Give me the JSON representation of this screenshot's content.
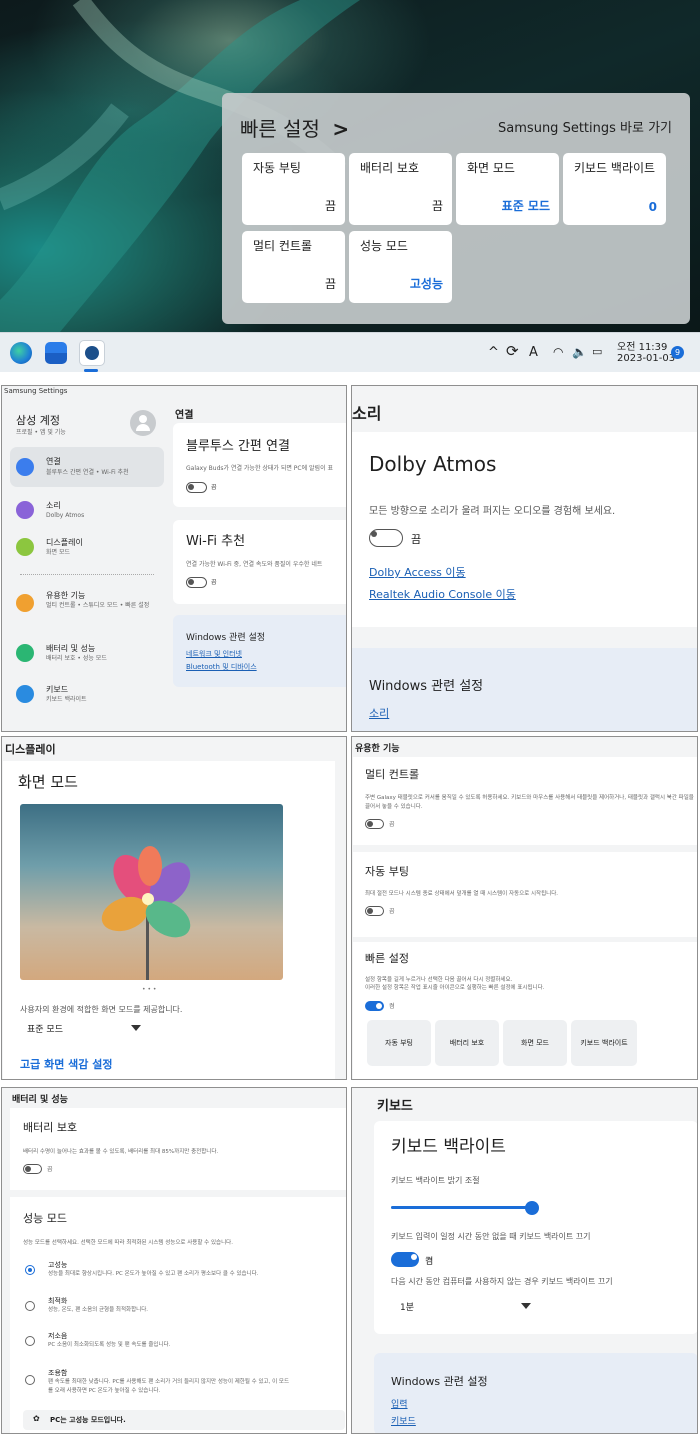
{
  "quick_settings": {
    "title": "빠른 설정",
    "chevron": ">",
    "shortcut": "Samsung Settings 바로 가기",
    "tiles": [
      {
        "label": "자동 부팅",
        "value": "끔"
      },
      {
        "label": "배터리 보호",
        "value": "끔"
      },
      {
        "label": "화면 모드",
        "value": "표준 모드"
      },
      {
        "label": "키보드 백라이트",
        "value": "0"
      },
      {
        "label": "멀티 컨트롤",
        "value": "끔"
      },
      {
        "label": "성능 모드",
        "value": "고성능"
      }
    ]
  },
  "taskbar": {
    "chevron": "^",
    "lang": "A",
    "time": "오전 11:39",
    "date": "2023-01-03",
    "badge": "9"
  },
  "settings_app": {
    "window_title": "Samsung Settings",
    "account": {
      "title": "삼성 계정",
      "sub": "프로필 • 앱 및 기능"
    },
    "nav": [
      {
        "title": "연결",
        "sub": "블루투스 간편 연결 • Wi-Fi 추천"
      },
      {
        "title": "소리",
        "sub": "Dolby Atmos"
      },
      {
        "title": "디스플레이",
        "sub": "화면 모드"
      },
      {
        "title": "유용한 기능",
        "sub": "멀티 컨트롤 • 스튜디오 모드 • 빠른 설정"
      },
      {
        "title": "배터리 및 성능",
        "sub": "배터리 보호 • 성능 모드"
      },
      {
        "title": "키보드",
        "sub": "키보드 백라이트"
      }
    ],
    "page_title": "연결",
    "bt": {
      "title": "블루투스 간편 연결",
      "desc": "Galaxy Buds가 연결 가능한 상태가 되면 PC에 알림이 표",
      "state": "끔"
    },
    "wifi": {
      "title": "Wi-Fi 추천",
      "desc": "연결 가능한 Wi-Fi 중, 연결 속도와 품질이 우수한 네트",
      "state": "끔"
    },
    "windows": {
      "title": "Windows 관련 설정",
      "link1": "네트워크 및 인터넷",
      "link2": "Bluetooth 및 디바이스"
    }
  },
  "sound": {
    "header": "소리",
    "title": "Dolby Atmos",
    "desc": "모든 방향으로 소리가 울려 퍼지는 오디오를 경험해 보세요.",
    "state": "끔",
    "link1": "Dolby Access 이동",
    "link2": "Realtek Audio Console 이동",
    "win_title": "Windows 관련 설정",
    "win_link": "소리"
  },
  "display": {
    "header": "디스플레이",
    "title": "화면 모드",
    "dots": "• • •",
    "desc": "사용자의 환경에 적합한 화면 모드를 제공합니다.",
    "select": "표준 모드",
    "advanced": "고급 화면 색감 설정"
  },
  "useful": {
    "header": "유용한 기능",
    "multi": {
      "title": "멀티 컨트롤",
      "desc": "주변 Galaxy 태블릿으로 커서를 움직일 수 있도록 허용하세요. 키보드와 마우스를 사용해서 태블릿을 제어하거나, 태블릿과 갤럭시 북간 파일을 끌어서 놓을 수 있습니다.",
      "state": "끔"
    },
    "autoboot": {
      "title": "자동 부팅",
      "desc": "최대 절전 모드나 시스템 종료 상태에서 덮개를 열 때 시스템이 자동으로 시작됩니다.",
      "state": "끔"
    },
    "quick": {
      "title": "빠른 설정",
      "desc1": "설정 항목을 길게 누르거나 선택한 다음 끌어서 다시 정렬하세요.",
      "desc2": "이러한 설정 항목은 작업 표시줄 아이콘으로 실행하는 빠른 설정에 표시됩니다.",
      "state": "켬",
      "tiles": [
        "자동 부팅",
        "배터리 보호",
        "화면 모드",
        "키보드 백라이트"
      ]
    }
  },
  "battery": {
    "header": "배터리 및 성능",
    "protect": {
      "title": "배터리 보호",
      "desc": "배터리 수명이 늘어나는 효과를 볼 수 있도록, 배터리를 최대 85%까지만 충전합니다.",
      "state": "끔"
    },
    "perf": {
      "title": "성능 모드",
      "desc": "성능 모드를 선택하세요. 선택한 모드에 따라 최적화된 시스템 성능으로 사용할 수 있습니다.",
      "options": [
        {
          "title": "고성능",
          "desc": "성능을 최대로 향상시킵니다. PC 온도가 높아질 수 있고 팬 소리가 평소보다 클 수 있습니다."
        },
        {
          "title": "최적화",
          "desc": "성능, 온도, 팬 소음의 균형을 최적화합니다."
        },
        {
          "title": "저소음",
          "desc": "PC 소음이 최소화되도록 성능 및 팬 속도를 줄입니다."
        },
        {
          "title": "조용함",
          "desc1": "팬 속도를 최대한 낮춥니다. PC를 사용해도 팬 소리가 거의 들리지 않지만 성능이 제한될 수 있고, 이 모드",
          "desc2": "를 오래 사용하면 PC 온도가 높아질 수 있습니다."
        }
      ],
      "footer": "PC는 고성능 모드입니다."
    }
  },
  "keyboard": {
    "header": "키보드",
    "title": "키보드 백라이트",
    "slider_label": "키보드 백라이트 밝기 조절",
    "slider_value": 1.0,
    "timeout_label": "키보드 입력이 일정 시간 동안 없을 때 키보드 백라이트 끄기",
    "toggle_state": "켬",
    "idle_label": "다음 시간 동안 컴퓨터를 사용하지 않는 경우 키보드 백라이트 끄기",
    "select": "1분",
    "win_title": "Windows 관련 설정",
    "link1": "입력",
    "link2": "키보드"
  }
}
